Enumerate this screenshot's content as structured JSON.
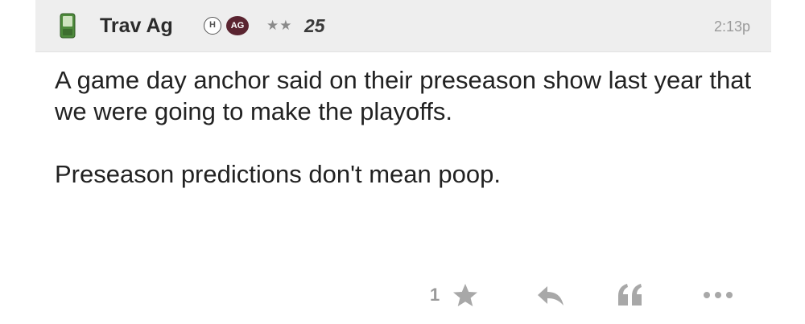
{
  "post": {
    "author": {
      "username": "Trav Ag",
      "badge_h": "H",
      "badge_ag": "AG",
      "stars": "★★",
      "level": "25",
      "device_icon": "phone-icon"
    },
    "timestamp": "2:13p",
    "body": {
      "paragraph_1": "A game day anchor said on their preseason show last year that we were going to make the playoffs.",
      "paragraph_2": "Preseason predictions don't mean poop."
    },
    "actions": {
      "like_count": "1",
      "like_icon": "star-icon",
      "reply_icon": "reply-icon",
      "quote_icon": "quote-icon",
      "more_icon": "more-icon"
    }
  },
  "colors": {
    "header_bg": "#eeeeee",
    "ag_badge": "#5a2430",
    "muted": "#9a9a9a",
    "phone_green": "#4e8a3c"
  }
}
